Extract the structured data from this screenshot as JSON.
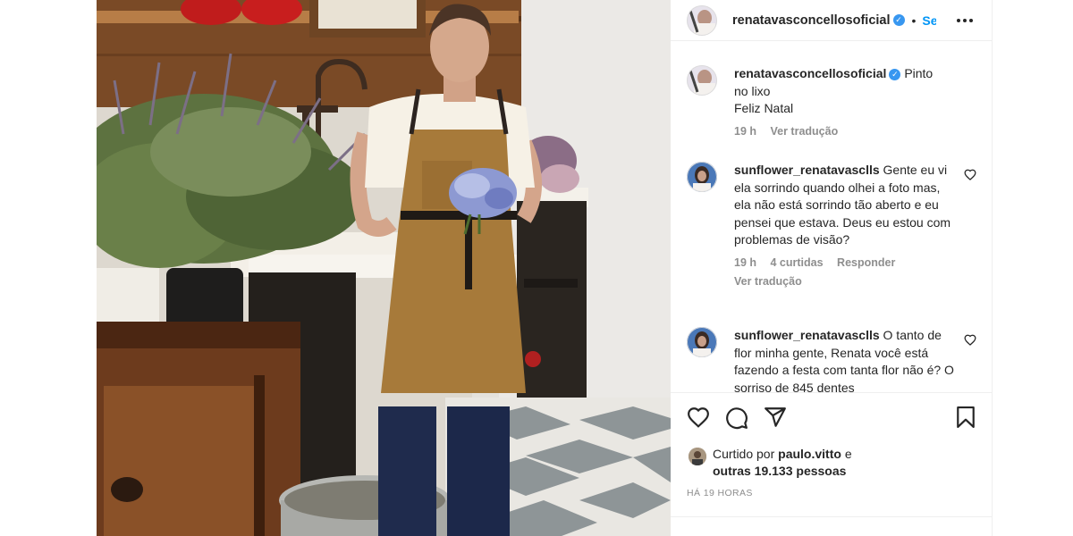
{
  "post": {
    "username": "renatavasconcellosoficial",
    "follow_label": "Seguir",
    "separator": "•"
  },
  "caption": {
    "username": "renatavasconcellosoficial",
    "text_line1": "Pinto",
    "text_line2": "no lixo",
    "text_line3": "Feliz Natal",
    "time": "19 h",
    "translate": "Ver tradução"
  },
  "comments": [
    {
      "username": "sunflower_renatavasclls",
      "text": "Gente eu vi ela sorrindo quando olhei a foto mas, ela não está sorrindo tão aberto e eu pensei que estava. Deus eu estou com problemas de visão?",
      "time": "19 h",
      "likes": "4 curtidas",
      "reply": "Responder",
      "translate": "Ver tradução"
    },
    {
      "username": "sunflower_renatavasclls",
      "text": "O tanto de flor minha gente, Renata você está fazendo a festa com tanta flor não é? O sorriso de 845 dentes"
    }
  ],
  "likes": {
    "prefix": "Curtido por",
    "liker": "paulo.vitto",
    "connector": "e",
    "others": "outras 19.133 pessoas"
  },
  "timestamp": "HÁ 19 HORAS",
  "icons": [
    "heart-icon",
    "comment-icon",
    "share-icon",
    "bookmark-icon",
    "more-icon",
    "verified-icon"
  ],
  "colors": {
    "link": "#0095f6",
    "verified": "#3897f0",
    "muted": "#8e8e8e",
    "apron": "#a77a3a"
  }
}
